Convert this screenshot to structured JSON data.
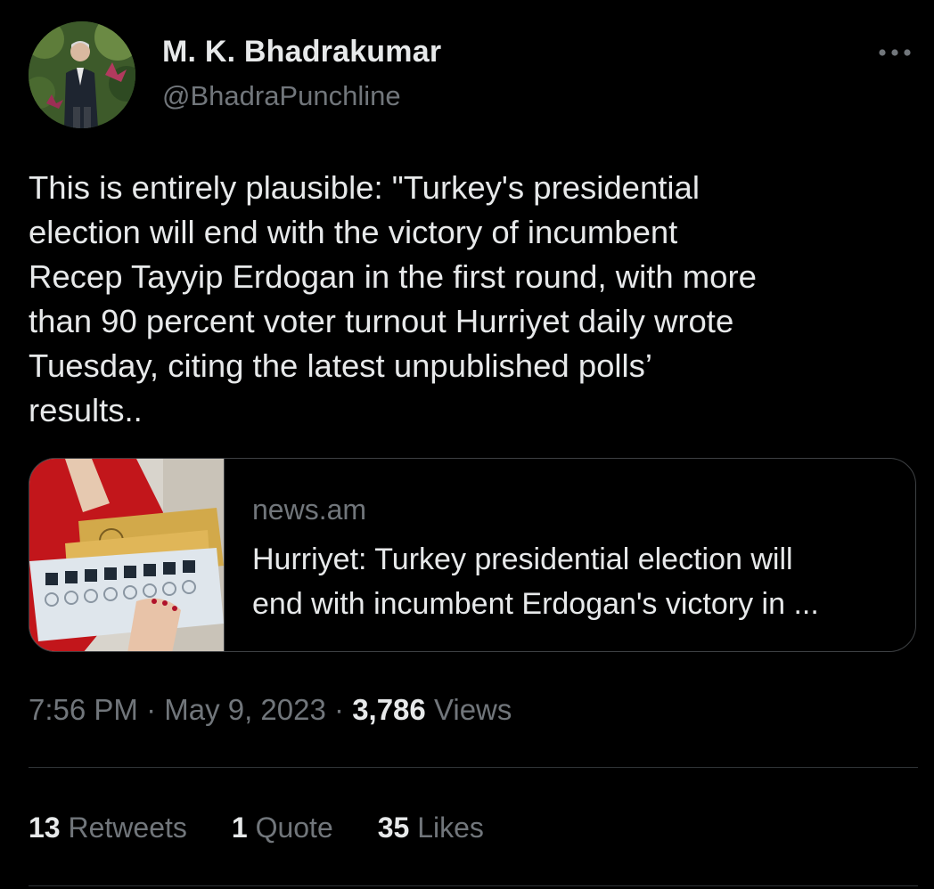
{
  "author": {
    "display_name": "M. K. Bhadrakumar",
    "handle": "@BhadraPunchline"
  },
  "icons": {
    "more": "more-options-icon"
  },
  "tweet": {
    "text": "This is entirely plausible: \"Turkey's presidential\nelection will end with the victory of incumbent\nRecep Tayyip Erdogan in the first round, with more\nthan 90 percent voter turnout Hurriyet daily wrote\nTuesday, citing the latest unpublished polls’\nresults.."
  },
  "card": {
    "domain": "news.am",
    "title_line1": "Hurriyet: Turkey presidential election will",
    "title_line2": "end with incumbent Erdogan's victory in ..."
  },
  "meta": {
    "time": "7:56 PM",
    "separator": " · ",
    "date": "May 9, 2023",
    "views_count": "3,786",
    "views_label": "Views"
  },
  "stats": {
    "retweets_count": "13",
    "retweets_label": "Retweets",
    "quotes_count": "1",
    "quotes_label": "Quote",
    "likes_count": "35",
    "likes_label": "Likes"
  },
  "colors": {
    "background": "#000000",
    "primary_text": "#e7e9ea",
    "secondary_text": "#71767b",
    "border": "#2f3336"
  }
}
